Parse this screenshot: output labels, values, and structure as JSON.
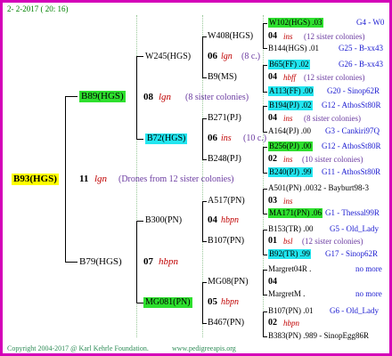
{
  "header": "2- 2-2017 ( 20: 16)",
  "root": {
    "name": "B93(HGS)",
    "gen": "11",
    "mating": "lgn",
    "note": "(Drones from 12 sister colonies)"
  },
  "left_top": {
    "name": "B89(HGS)",
    "gen": "08",
    "mating": "lgn",
    "note": "(8 sister colonies)"
  },
  "left_bot": {
    "name": "B79(HGS)",
    "gen": "07",
    "mating": "hbpn"
  },
  "w245": {
    "name": "W245(HGS)",
    "gen": "06",
    "mating": "lgn",
    "note": "(8 c.)"
  },
  "b72": {
    "name": "B72(HGS)",
    "gen": "06",
    "mating": "ins",
    "note": "(10 c.)"
  },
  "b300": {
    "name": "B300(PN)",
    "gen": "04",
    "mating": "hbpn"
  },
  "mg081": {
    "name": "MG081(PN)",
    "gen": "05",
    "mating": "hbpn"
  },
  "w408": {
    "name": "W408(HGS)",
    "gen": "04",
    "mating": "ins",
    "note": "(12 sister colonies)"
  },
  "b9": {
    "name": "B9(MS)"
  },
  "b271": {
    "name": "B271(PJ)"
  },
  "b248": {
    "name": "B248(PJ)"
  },
  "a517": {
    "name": "A517(PN)",
    "gen": "03",
    "mating": "ins"
  },
  "b107a": {
    "name": "B107(PN)"
  },
  "mg08": {
    "name": "MG08(PN)",
    "gen": "04"
  },
  "b467": {
    "name": "B467(PN)",
    "gen": "02",
    "mating": "hbpn"
  },
  "r": [
    {
      "name": "W102(HGS) .03",
      "right": "G4 - W0"
    },
    {
      "gen": "04",
      "mating": "ins",
      "note": "(12 sister colonies)"
    },
    {
      "name": "B144(HGS) .01",
      "right": "G25 - B-xx43"
    },
    {
      "name": "B65(FF) .02",
      "right": "G26 - B-xx43"
    },
    {
      "gen": "04",
      "mating": "hbff",
      "note": "(12 sister colonies)"
    },
    {
      "name": "A113(FF) .00",
      "right": "G20 - Sinop62R"
    },
    {
      "name": "B194(PJ) .02",
      "right": "G12 - AthosSt80R"
    },
    {
      "gen": "04",
      "mating": "ins",
      "note": "(8 sister colonies)"
    },
    {
      "name": "A164(PJ) .00",
      "right": "G3 - Cankiri97Q"
    },
    {
      "name": "B256(PJ) .00",
      "right": "G12 - AthosSt80R"
    },
    {
      "gen": "02",
      "mating": "ins",
      "note": "(10 sister colonies)"
    },
    {
      "name": "B240(PJ) .99",
      "right": "G11 - AthosSt80R"
    },
    {
      "name": "A501(PN) .0032 - Bayburt98-3"
    },
    {
      "name": "MA171(PN) .06",
      "right": "G1 - Thessal99R"
    },
    {
      "name": "B153(TR) .00",
      "right": "G5 - Old_Lady"
    },
    {
      "gen": "01",
      "mating": "bsl",
      "note": "(12 sister colonies)"
    },
    {
      "name": "B92(TR) .99",
      "right": "G17 - Sinop62R"
    },
    {
      "name": "Margret04R .",
      "right": "no more"
    },
    {
      "name": "MargretM .",
      "right": "no more"
    },
    {
      "name": "B107(PN) .01",
      "right": "G6 - Old_Lady"
    },
    {
      "name": "B383(PN) .989 - SinopEgg86R"
    }
  ],
  "footer": {
    "copy": "Copyright 2004-2017 @ Karl Kehrle Foundation.",
    "url": "www.pedigreeapis.org"
  }
}
